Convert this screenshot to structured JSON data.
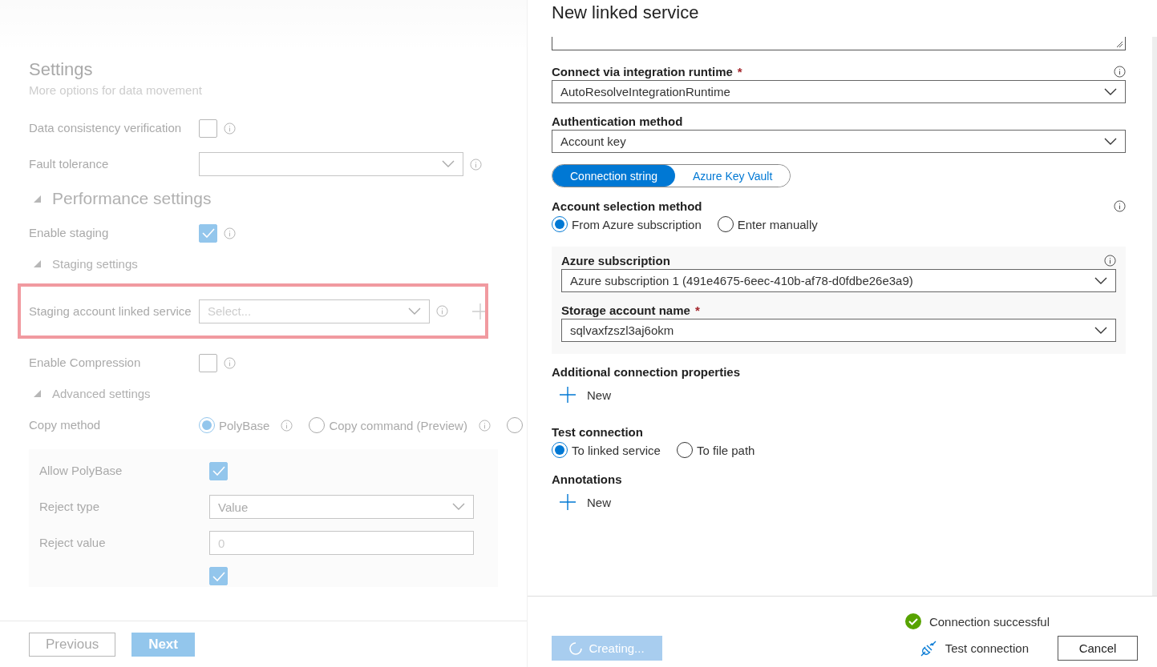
{
  "settings": {
    "title": "Settings",
    "subtitle": "More options for data movement",
    "rows": [
      {
        "kind": "checkbox",
        "label": "Data consistency verification",
        "checked": false,
        "info": true
      },
      {
        "kind": "dropdown",
        "label": "Fault tolerance",
        "info": true
      },
      {
        "kind": "heading",
        "label": "Performance settings",
        "expanded": true
      },
      {
        "kind": "checkbox",
        "label": "Enable staging",
        "checked": true,
        "info": true
      },
      {
        "kind": "subheading",
        "label": "Staging settings",
        "expanded": true
      },
      {
        "kind": "dropdown",
        "label": "Staging account linked service",
        "placeholder": "Select...",
        "info": true,
        "highlighted": true,
        "add_new": true
      },
      {
        "kind": "checkbox",
        "label": "Enable Compression",
        "checked": false,
        "info": true
      },
      {
        "kind": "subheading",
        "label": "Advanced settings",
        "expanded": true
      },
      {
        "kind": "radio",
        "label": "Copy method",
        "options": [
          {
            "label": "PolyBase",
            "selected": true,
            "info": true
          },
          {
            "label": "Copy command (Preview)",
            "selected": false,
            "info": true
          },
          {
            "selected": false,
            "info": false
          }
        ]
      }
    ],
    "polybase_rows": [
      {
        "kind": "checkbox",
        "label": "Allow PolyBase",
        "checked": true,
        "info": false
      },
      {
        "kind": "dropdown",
        "label": "Reject type",
        "value": "Value",
        "info": false
      },
      {
        "kind": "input",
        "label": "Reject value",
        "placeholder": "0",
        "info": false
      },
      {
        "kind": "checkbox",
        "checked": true,
        "info": false
      }
    ]
  },
  "wizard_buttons": [
    {
      "label": "Previous",
      "primary": false
    },
    {
      "label": "Next",
      "primary": true
    }
  ],
  "linked_service": {
    "title": "New linked service",
    "fields": [
      {
        "kind": "textarea"
      },
      {
        "kind": "dropdown",
        "label": "Connect via integration runtime",
        "required_mark": "*",
        "info": true,
        "value": "AutoResolveIntegrationRuntime"
      },
      {
        "kind": "dropdown",
        "label": "Authentication method",
        "info": false,
        "value": "Account key"
      },
      {
        "kind": "toggle",
        "options": [
          {
            "label": "Connection string",
            "selected": true
          },
          {
            "label": "Azure Key Vault",
            "selected": false
          }
        ]
      },
      {
        "kind": "radio",
        "label": "Account selection method",
        "info": true,
        "options": [
          {
            "label": "From Azure subscription",
            "selected": true
          },
          {
            "label": "Enter manually",
            "selected": false
          }
        ]
      },
      {
        "kind": "group",
        "fields": [
          {
            "kind": "dropdown",
            "label": "Azure subscription",
            "info": true,
            "value": "Azure subscription 1 (491e4675-6eec-410b-af78-d0fdbe26e3a9)"
          },
          {
            "kind": "dropdown",
            "label": "Storage account name",
            "required_mark": "*",
            "info": false,
            "value": "sqlvaxfzszl3aj6okm"
          }
        ]
      },
      {
        "kind": "add",
        "label": "Additional connection properties",
        "button": "New"
      },
      {
        "kind": "radio",
        "label": "Test connection",
        "info": false,
        "options": [
          {
            "label": "To linked service",
            "selected": true
          },
          {
            "label": "To file path",
            "selected": false
          }
        ]
      },
      {
        "kind": "add",
        "label": "Annotations",
        "button": "New"
      }
    ],
    "status": {
      "kind": "success",
      "text": "Connection successful"
    },
    "create_button": {
      "label": "Creating...",
      "busy": true
    },
    "test_button": "Test connection",
    "cancel_button": "Cancel"
  }
}
